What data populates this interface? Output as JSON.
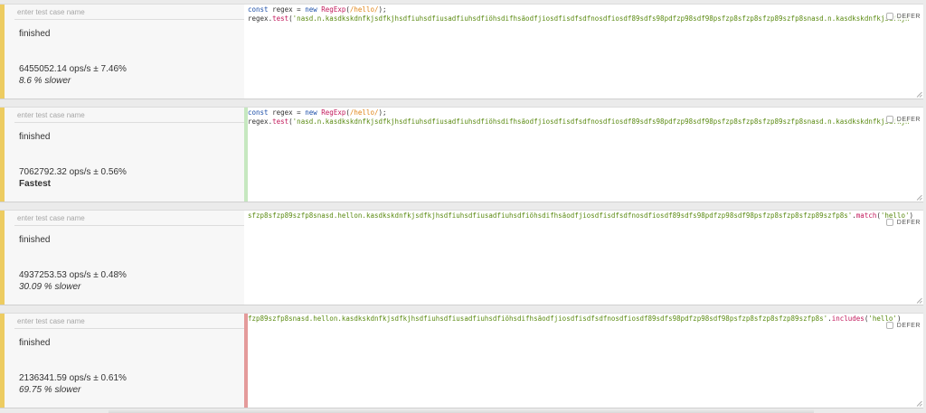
{
  "defer_label": "DEFER",
  "cases": [
    {
      "placeholder": "enter test case name",
      "status": "finished",
      "ops": "6455052.14 ops/s ± 7.46%",
      "comparison": "8.6 % slower",
      "line1": [
        {
          "c": "kw",
          "t": "const"
        },
        {
          "c": "pl",
          "t": " regex = "
        },
        {
          "c": "kw",
          "t": "new"
        },
        {
          "c": "pl",
          "t": " "
        },
        {
          "c": "fn",
          "t": "RegExp"
        },
        {
          "c": "pl",
          "t": "("
        },
        {
          "c": "re",
          "t": "/hello/"
        },
        {
          "c": "pl",
          "t": ");"
        }
      ],
      "line2": [
        {
          "c": "pl",
          "t": "regex."
        },
        {
          "c": "fn",
          "t": "test"
        },
        {
          "c": "pl",
          "t": "("
        },
        {
          "c": "str",
          "t": "'nasd.n.kasdkskdnfkjsdfkjhsdfiuhsdfiusadfiuhsdfiöhsdifhsäodfjiosdfisdfsdfnosdfiosdf89sdfs98pdfzp98sdf98psfzp8sfzp8sfzp89szfp8snasd.n.kasdkskdnfkjsdfkjh"
        }
      ]
    },
    {
      "placeholder": "enter test case name",
      "status": "finished",
      "ops": "7062792.32 ops/s ± 0.56%",
      "comparison": "Fastest",
      "line1": [
        {
          "c": "kw",
          "t": "const"
        },
        {
          "c": "pl",
          "t": " regex = "
        },
        {
          "c": "kw",
          "t": "new"
        },
        {
          "c": "pl",
          "t": " "
        },
        {
          "c": "fn",
          "t": "RegExp"
        },
        {
          "c": "pl",
          "t": "("
        },
        {
          "c": "re",
          "t": "/hello/"
        },
        {
          "c": "pl",
          "t": ");"
        }
      ],
      "line2": [
        {
          "c": "pl",
          "t": "regex."
        },
        {
          "c": "fn",
          "t": "test"
        },
        {
          "c": "pl",
          "t": "("
        },
        {
          "c": "str",
          "t": "'nasd.n.kasdkskdnfkjsdfkjhsdfiuhsdfiusadfiuhsdfiöhsdifhsäodfjiosdfisdfsdfnosdfiosdf89sdfs98pdfzp98sdf98psfzp8sfzp8sfzp89szfp8snasd.n.kasdkskdnfkjsdfkjh"
        }
      ]
    },
    {
      "placeholder": "enter test case name",
      "status": "finished",
      "ops": "4937253.53 ops/s ± 0.48%",
      "comparison": "30.09 % slower",
      "line1": [
        {
          "c": "str",
          "t": "sfzp8sfzp89szfp8snasd.hellon.kasdkskdnfkjsdfkjhsdfiuhsdfiusadfiuhsdfiöhsdifhsäodfjiosdfisdfsdfnosdfiosdf89sdfs98pdfzp98sdf98psfzp8sfzp8sfzp89szfp8s'"
        },
        {
          "c": "pl",
          "t": "."
        },
        {
          "c": "fn",
          "t": "match"
        },
        {
          "c": "pl",
          "t": "("
        },
        {
          "c": "str",
          "t": "'hello'"
        },
        {
          "c": "pl",
          "t": ")"
        }
      ],
      "line2": []
    },
    {
      "placeholder": "enter test case name",
      "status": "finished",
      "ops": "2136341.59 ops/s ± 0.61%",
      "comparison": "69.75 % slower",
      "line1": [
        {
          "c": "str",
          "t": "fzp89szfp8snasd.hellon.kasdkskdnfkjsdfkjhsdfiuhsdfiusadfiuhsdfiöhsdifhsäodfjiosdfisdfsdfnosdfiosdf89sdfs98pdfzp98sdf98psfzp8sfzp8sfzp89szfp8s'"
        },
        {
          "c": "pl",
          "t": "."
        },
        {
          "c": "fn",
          "t": "includes"
        },
        {
          "c": "pl",
          "t": "("
        },
        {
          "c": "str",
          "t": "'hello'"
        },
        {
          "c": "pl",
          "t": ")"
        }
      ],
      "line2": []
    }
  ]
}
